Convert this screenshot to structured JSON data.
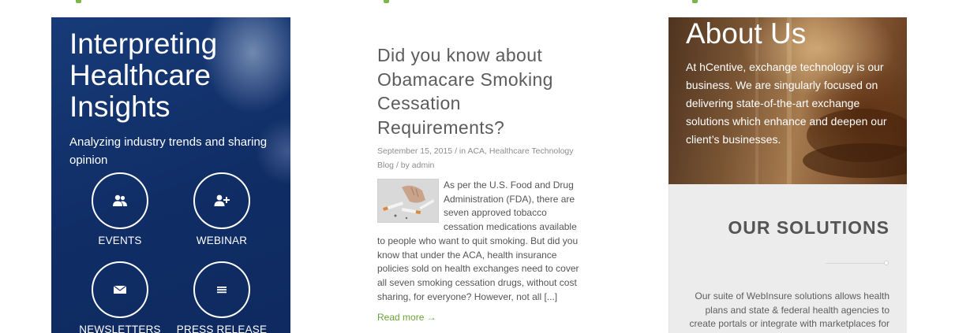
{
  "insights": {
    "title": "Interpreting Healthcare Insights",
    "subtitle": "Analyzing industry trends and sharing opinion",
    "buttons": [
      {
        "label": "EVENTS",
        "icon": "users-icon"
      },
      {
        "label": "WEBINAR",
        "icon": "add-user-icon"
      },
      {
        "label": "NEWSLETTERS",
        "icon": "envelope-icon"
      },
      {
        "label": "PRESS RELEASE",
        "icon": "list-icon"
      }
    ]
  },
  "post": {
    "title": "Did you know about Obamacare Smoking Cessation Requirements?",
    "date": "September 15, 2015",
    "in_prefix": "in",
    "category1": "ACA",
    "category2": "Healthcare Technology Blog",
    "by_prefix": "by",
    "author": "admin",
    "excerpt": "As per the U.S. Food and Drug Administration (FDA), there are seven approved tobacco cessation medications available to people who want to quit smoking. But  did you know that under the ACA, health insurance policies sold on health exchanges need to cover all seven smoking cessation drugs, without cost sharing, for everyone? However, not all [...]",
    "read_more": "Read more →"
  },
  "about": {
    "title": "About Us",
    "text": "At hCentive, exchange technology is our business. We are singularly focused on delivering state-of-the-art exchange solutions which enhance and deepen our client’s businesses."
  },
  "solutions": {
    "title": "OUR SOLUTIONS",
    "text": "Our suite of WebInsure solutions allows health plans and state & federal health agencies to create portals or integrate with marketplaces for"
  },
  "colors": {
    "accent_green": "#7ab648",
    "navy": "#143672",
    "text_gray": "#5c5c5c"
  }
}
